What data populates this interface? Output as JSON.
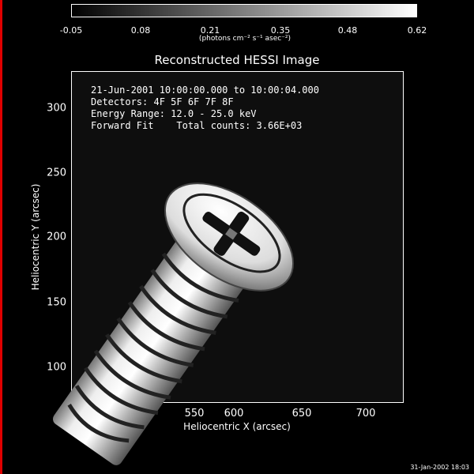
{
  "colorbar": {
    "ticks": [
      "-0.05",
      "0.08",
      "0.21",
      "0.35",
      "0.48",
      "0.62"
    ],
    "unit_label": "(photons cm⁻² s⁻¹ asec⁻²)"
  },
  "annotations": [
    "21-Jun-2001 10:00:00.000 to 10:00:04.000",
    "Detectors: 4F 5F 6F 7F 8F",
    "Energy Range: 12.0 - 25.0 keV",
    "Forward Fit    Total counts: 3.66E+03"
  ],
  "footer_timestamp": "31-Jan-2002 18:03",
  "chart_data": {
    "type": "heatmap",
    "title": "Reconstructed HESSI Image",
    "xlabel": "Heliocentric X (arcsec)",
    "ylabel": "Heliocentric Y (arcsec)",
    "xlim": [
      515,
      735
    ],
    "ylim": [
      70,
      325
    ],
    "xticks": [
      550,
      600,
      650,
      700
    ],
    "yticks": [
      100,
      150,
      200,
      250,
      300
    ],
    "colorbar_range": [
      -0.05,
      0.62
    ],
    "colormap": "grayscale",
    "image_subject": "screw (pan head, phillips, threaded shank)"
  }
}
